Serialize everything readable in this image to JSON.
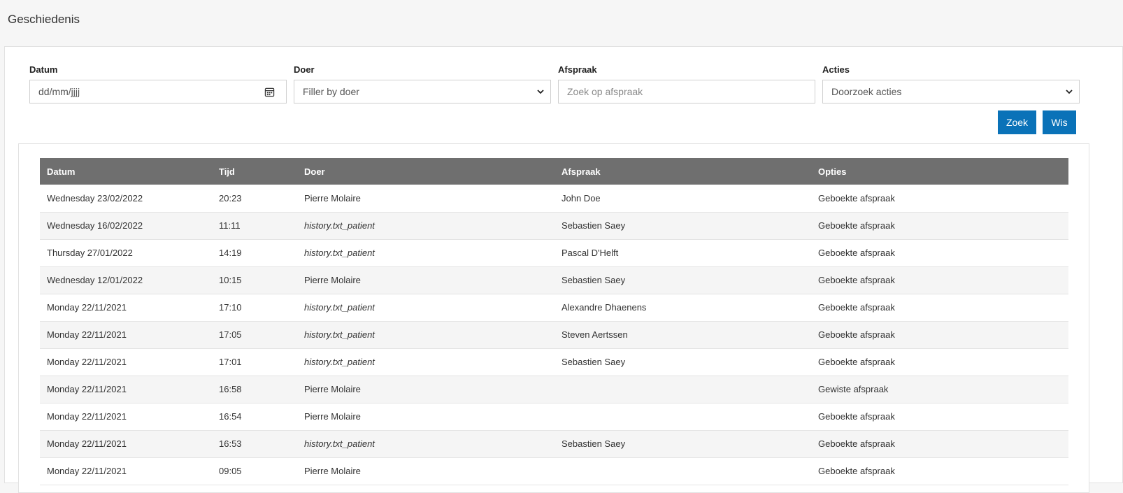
{
  "page": {
    "title": "Geschiedenis"
  },
  "filters": {
    "datum": {
      "label": "Datum",
      "placeholder": "dd/mm/jjjj"
    },
    "doer": {
      "label": "Doer",
      "value": "Filler by doer"
    },
    "afspraak": {
      "label": "Afspraak",
      "placeholder": "Zoek op afspraak"
    },
    "acties": {
      "label": "Acties",
      "value": "Doorzoek acties"
    }
  },
  "buttons": {
    "search": "Zoek",
    "clear": "Wis"
  },
  "colors": {
    "accent": "#0a72b8",
    "table_header": "#6f6f6f"
  },
  "table": {
    "headers": [
      "Datum",
      "Tijd",
      "Doer",
      "Afspraak",
      "Opties"
    ],
    "rows": [
      [
        "Wednesday 23/02/2022",
        "20:23",
        "Pierre Molaire",
        "John Doe",
        "Geboekte afspraak"
      ],
      [
        "Wednesday 16/02/2022",
        "11:11",
        "history.txt_patient",
        "Sebastien Saey",
        "Geboekte afspraak"
      ],
      [
        "Thursday 27/01/2022",
        "14:19",
        "history.txt_patient",
        "Pascal D'Helft",
        "Geboekte afspraak"
      ],
      [
        "Wednesday 12/01/2022",
        "10:15",
        "Pierre Molaire",
        "Sebastien Saey",
        "Geboekte afspraak"
      ],
      [
        "Monday 22/11/2021",
        "17:10",
        "history.txt_patient",
        "Alexandre Dhaenens",
        "Geboekte afspraak"
      ],
      [
        "Monday 22/11/2021",
        "17:05",
        "history.txt_patient",
        "Steven Aertssen",
        "Geboekte afspraak"
      ],
      [
        "Monday 22/11/2021",
        "17:01",
        "history.txt_patient",
        "Sebastien Saey",
        "Geboekte afspraak"
      ],
      [
        "Monday 22/11/2021",
        "16:58",
        "Pierre Molaire",
        "",
        "Gewiste afspraak"
      ],
      [
        "Monday 22/11/2021",
        "16:54",
        "Pierre Molaire",
        "",
        "Geboekte afspraak"
      ],
      [
        "Monday 22/11/2021",
        "16:53",
        "history.txt_patient",
        "Sebastien Saey",
        "Geboekte afspraak"
      ],
      [
        "Monday 22/11/2021",
        "09:05",
        "Pierre Molaire",
        "",
        "Geboekte afspraak"
      ]
    ]
  }
}
